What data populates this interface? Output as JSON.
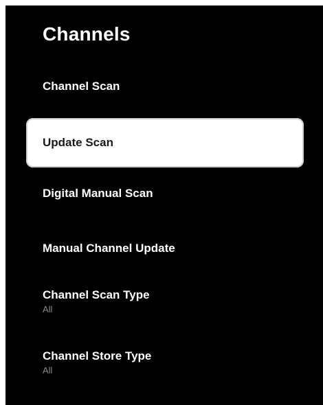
{
  "screen": {
    "title": "Channels"
  },
  "menu": {
    "items": [
      {
        "label": "Channel Scan",
        "sub": ""
      },
      {
        "label": "Update Scan",
        "sub": "",
        "focused": true
      },
      {
        "label": "Digital Manual Scan",
        "sub": ""
      },
      {
        "label": "Manual Channel Update",
        "sub": ""
      },
      {
        "label": "Channel Scan Type",
        "sub": "All"
      },
      {
        "label": "Channel Store Type",
        "sub": "All"
      }
    ]
  },
  "colors": {
    "background": "#000000",
    "focus_background": "#ffffff",
    "text": "#ffffff",
    "focus_text": "#1a1a1a",
    "subtext": "#8a8a8a"
  }
}
